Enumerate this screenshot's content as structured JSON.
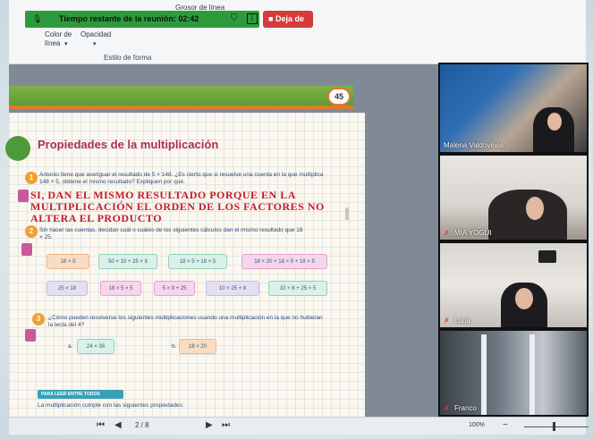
{
  "ribbon": {
    "top_label": "Grosor de línea",
    "color_label": "Color de",
    "color_label2": "línea",
    "opacity_label": "Opacidad",
    "style_label": "Estilo de forma"
  },
  "meeting": {
    "timer_text": "Tiempo restante de la reunión: 02:42",
    "leave_label": "Deja de",
    "accent": "#2d9b3c",
    "leave_color": "#d63a3a"
  },
  "document": {
    "page_badge": "45",
    "title": "Propiedades de la multiplicación",
    "q1_text": "Antonio tiene que averiguar el resultado de 5 × 148. ¿Es cierto que si resuelve una cuenta en la que multiplica 148 × 5, obtiene el mismo resultado? Expliquen por qué.",
    "answer_text": "SI, DAN EL MISMO RESULTADO PORQUE EN LA MULTIPLICACIÓN EL ORDEN DE LOS FACTORES NO ALTERA EL PRODUCTO",
    "q2_text": "Sin hacer las cuentas, decidan cuál o cuáles de los siguientes cálculos dan el mismo resultado que 18 × 25.",
    "row1": [
      "18 × 5",
      "50 × 10 + 25 × 8",
      "18 × 5 + 18 × 5",
      "18 × 20 + 18 × 5 + 18 × 5"
    ],
    "row2": [
      "25 × 18",
      "18 × 5 × 5",
      "5 × 9 + 25",
      "10 × 25 + 8",
      "10 × 8 + 25 × 5"
    ],
    "q3_text": "¿Cómo pueden resolverse los siguientes multiplicaciones usando una multiplicación en la que no hubieran la tecla del 4?",
    "q3_a": "24 × 36",
    "q3_b": "18 × 20",
    "tag_text": "PARA LEER ENTRE TODOS",
    "last_line": "La multiplicación cumple con las siguientes propiedades:",
    "heading_color": "#b02b55",
    "answer_color": "#c21d2c"
  },
  "statusbar": {
    "page_indicator": "2 / 8",
    "zoom": "100%"
  },
  "participants": [
    {
      "name": "Malena Valdovinos",
      "muted": false
    },
    {
      "name": "MIA YOGUI",
      "muted": true
    },
    {
      "name": "Luna",
      "muted": true
    },
    {
      "name": "Franco",
      "muted": true
    }
  ],
  "icons": {
    "mic": "microphone-icon",
    "shield": "shield-icon",
    "info": "info-icon",
    "stop": "stop-icon",
    "muted": "mic-off-icon"
  }
}
